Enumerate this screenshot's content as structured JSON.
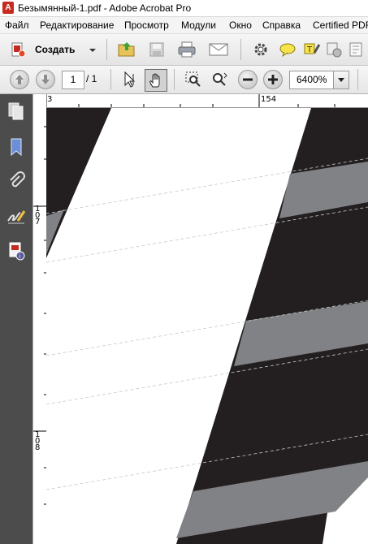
{
  "window": {
    "title": "Безымянный-1.pdf - Adobe Acrobat Pro"
  },
  "menu": [
    "Файл",
    "Редактирование",
    "Просмотр",
    "Модули",
    "Окно",
    "Справка",
    "Certified PDF"
  ],
  "toolbar": {
    "create_label": "Создать"
  },
  "nav": {
    "page_current": "1",
    "page_total": "/ 1",
    "zoom": "6400%"
  },
  "ruler": {
    "h_labels": [
      "3",
      "154"
    ],
    "v_labels": [
      "1\n0\n7",
      "1\n0\n8"
    ]
  },
  "colors": {
    "sidebar": "#4c4c4c",
    "dark_stripe": "#231f20",
    "gray_stripe": "#808285",
    "accent_red": "#c62b1f"
  }
}
